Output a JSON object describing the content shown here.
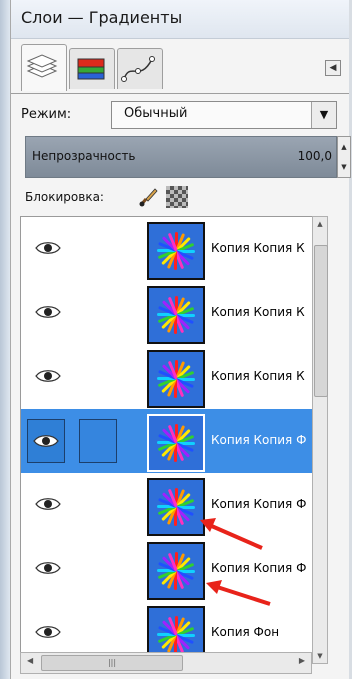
{
  "window": {
    "title": "Слои — Градиенты"
  },
  "tabs": [
    {
      "icon": "layers-icon"
    },
    {
      "icon": "channels-icon"
    },
    {
      "icon": "paths-icon"
    }
  ],
  "tab_menu_icon": "tab-menu-icon",
  "mode": {
    "label": "Режим:",
    "value": "Обычный"
  },
  "opacity": {
    "label": "Непрозрачность",
    "value": "100,0"
  },
  "lock": {
    "label": "Блокировка:"
  },
  "layers": [
    {
      "name": "Копия Копия К",
      "selected": false
    },
    {
      "name": "Копия Копия К",
      "selected": false
    },
    {
      "name": "Копия Копия К",
      "selected": false
    },
    {
      "name": "Копия Копия Ф",
      "selected": true
    },
    {
      "name": "Копия Копия Ф",
      "selected": false
    },
    {
      "name": "Копия Копия Ф",
      "selected": false
    },
    {
      "name": "Копия Фон",
      "selected": false
    }
  ],
  "colors": {
    "selection": "#3d8ee6",
    "thumb_bg": "#2f6fd8",
    "annotation_arrow": "#e8231a"
  }
}
